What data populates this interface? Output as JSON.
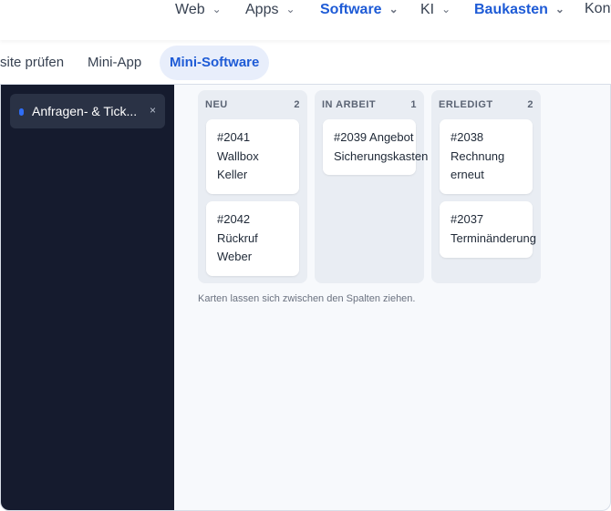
{
  "topnav": {
    "items": [
      {
        "label": "Web",
        "active": false
      },
      {
        "label": "Apps",
        "active": false
      },
      {
        "label": "Software",
        "active": true
      },
      {
        "label": "KI",
        "active": false
      },
      {
        "label": "Baukasten",
        "active": true
      },
      {
        "label": "Kont",
        "active": false
      }
    ],
    "chevron": "chevron-down-icon"
  },
  "subtabs": [
    {
      "label": "site prüfen",
      "active": false
    },
    {
      "label": "Mini-App",
      "active": false
    },
    {
      "label": "Mini-Software",
      "active": true
    }
  ],
  "sidebar": {
    "tab_label": "Anfragen- & Tick...",
    "close": "×",
    "dot_color": "#2f6df6"
  },
  "board": {
    "columns": [
      {
        "title": "NEU",
        "count": "2",
        "cards": [
          {
            "text": "#2041\nWallbox\nKeller"
          },
          {
            "text": "#2042\nRückruf\nWeber"
          }
        ]
      },
      {
        "title": "IN ARBEIT",
        "count": "1",
        "cards": [
          {
            "text": "#2039 Angebot\nSicherungskasten"
          }
        ]
      },
      {
        "title": "ERLEDIGT",
        "count": "2",
        "cards": [
          {
            "text": "#2038\nRechnung\nerneut"
          },
          {
            "text": "#2037\nTerminänderung"
          }
        ]
      }
    ],
    "hint": "Karten lassen sich zwischen den Spalten ziehen."
  },
  "colors": {
    "accent": "#1e5bd6",
    "sidebar_bg": "#151b2e",
    "column_bg": "#e9edf3"
  }
}
